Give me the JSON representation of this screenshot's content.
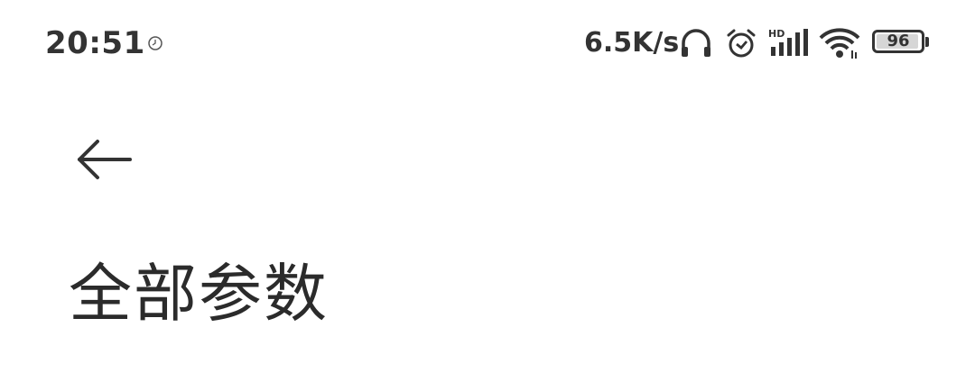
{
  "status_bar": {
    "time": "20:51",
    "net_speed": "6.5K/s",
    "signal_label": "HD",
    "battery_level": "96",
    "battery_fraction": 0.96,
    "icons": [
      "sync-icon",
      "headphone-icon",
      "alarm-icon",
      "signal-icon",
      "wifi-icon",
      "battery-icon"
    ]
  },
  "header": {
    "back_icon": "arrow-left-icon",
    "title": "全部参数"
  },
  "colors": {
    "text": "#333333",
    "background": "#ffffff"
  }
}
